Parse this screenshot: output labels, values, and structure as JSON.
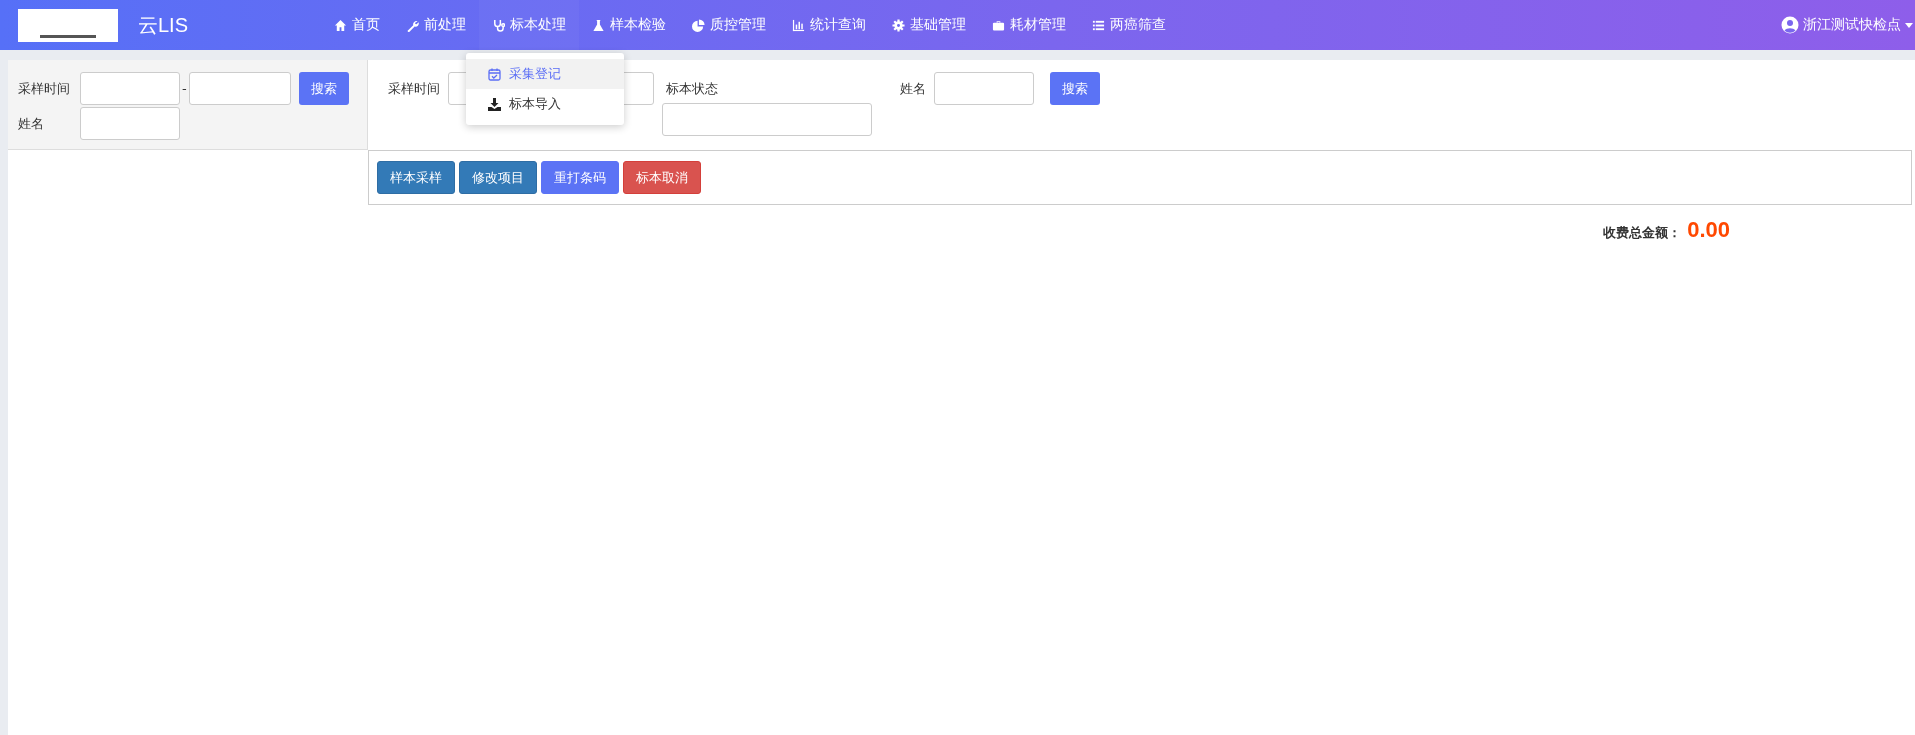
{
  "navbar": {
    "title": "云LIS",
    "menu": [
      {
        "label": "首页",
        "expanded": false
      },
      {
        "label": "前处理",
        "expanded": false
      },
      {
        "label": "标本处理",
        "expanded": true
      },
      {
        "label": "样本检验",
        "expanded": false
      },
      {
        "label": "质控管理",
        "expanded": false
      },
      {
        "label": "统计查询",
        "expanded": false
      },
      {
        "label": "基础管理",
        "expanded": false
      },
      {
        "label": "耗材管理",
        "expanded": false
      },
      {
        "label": "两癌筛查",
        "expanded": false
      }
    ],
    "user": "浙江测试快检点"
  },
  "dropdown": {
    "items": [
      {
        "label": "采集登记",
        "selected": true
      },
      {
        "label": "标本导入",
        "selected": false
      }
    ]
  },
  "left_filter": {
    "time_label": "采样时间",
    "range_separator": "-",
    "name_label": "姓名",
    "search_button": "搜索"
  },
  "right_filter": {
    "time_label": "采样时间",
    "status_label": "标本状态",
    "name_label": "姓名",
    "search_button": "搜索"
  },
  "toolbar": {
    "buttons": [
      {
        "label": "样本采样",
        "kind": "primary"
      },
      {
        "label": "修改项目",
        "kind": "primary"
      },
      {
        "label": "重打条码",
        "kind": "accent"
      },
      {
        "label": "标本取消",
        "kind": "danger"
      }
    ]
  },
  "total": {
    "label": "收费总金额：",
    "value": "0.00"
  }
}
